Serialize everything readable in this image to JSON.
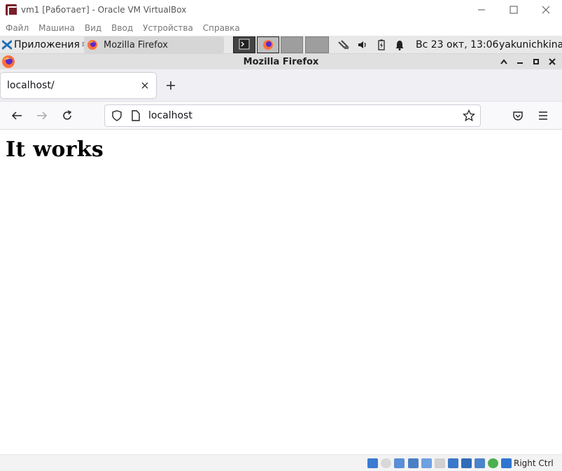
{
  "vbox": {
    "title": "vm1 [Работает] - Oracle VM VirtualBox",
    "menu": [
      "Файл",
      "Машина",
      "Вид",
      "Ввод",
      "Устройства",
      "Справка"
    ],
    "status_host_key": "Right Ctrl"
  },
  "panel": {
    "apps_label": "Приложения",
    "separator": "≡",
    "task_label": "Mozilla Firefox",
    "clock": "Вс 23 окт, 13:06",
    "user": "yakunichkina"
  },
  "firefox": {
    "window_title": "Mozilla Firefox",
    "tab_title": "localhost/",
    "url": "localhost"
  },
  "page": {
    "heading": "It works"
  },
  "colors": {
    "panel_bg": "#e8e8e8",
    "firefox_chrome": "#f0f0f4",
    "vbox_logo": "#7a1f2b"
  }
}
